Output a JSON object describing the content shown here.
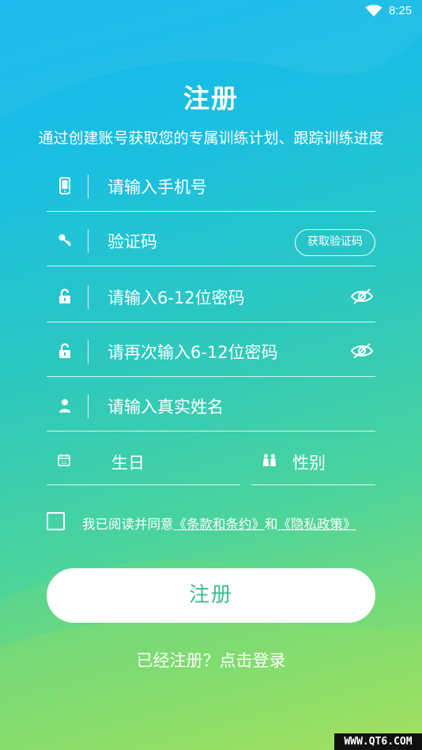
{
  "status_bar": {
    "time": "8:25",
    "wifi_icon": "wifi-icon"
  },
  "page": {
    "title": "注册",
    "subtitle": "通过创建账号获取您的专属训练计划、跟踪训练进度"
  },
  "form": {
    "phone": {
      "placeholder": "请输入手机号",
      "icon": "phone-icon"
    },
    "code": {
      "placeholder": "验证码",
      "icon": "key-icon",
      "button_label": "获取验证码"
    },
    "password": {
      "placeholder": "请输入6-12位密码",
      "icon": "lock-icon",
      "toggle_icon": "eye-hidden-icon"
    },
    "password_confirm": {
      "placeholder": "请再次输入6-12位密码",
      "icon": "lock-icon",
      "toggle_icon": "eye-hidden-icon"
    },
    "real_name": {
      "placeholder": "请输入真实姓名",
      "icon": "person-icon"
    },
    "birthday": {
      "placeholder": "生日",
      "icon": "calendar-icon"
    },
    "gender": {
      "placeholder": "性别",
      "icon": "gender-icon"
    }
  },
  "agreement": {
    "prefix": "我已阅读并同意",
    "terms_link": "《条款和条约》",
    "conjunction": "和",
    "privacy_link": "《隐私政策》",
    "checked": false
  },
  "submit_label": "注册",
  "login_link": "已经注册？点击登录",
  "watermark": "WWW.QT6.COM"
}
